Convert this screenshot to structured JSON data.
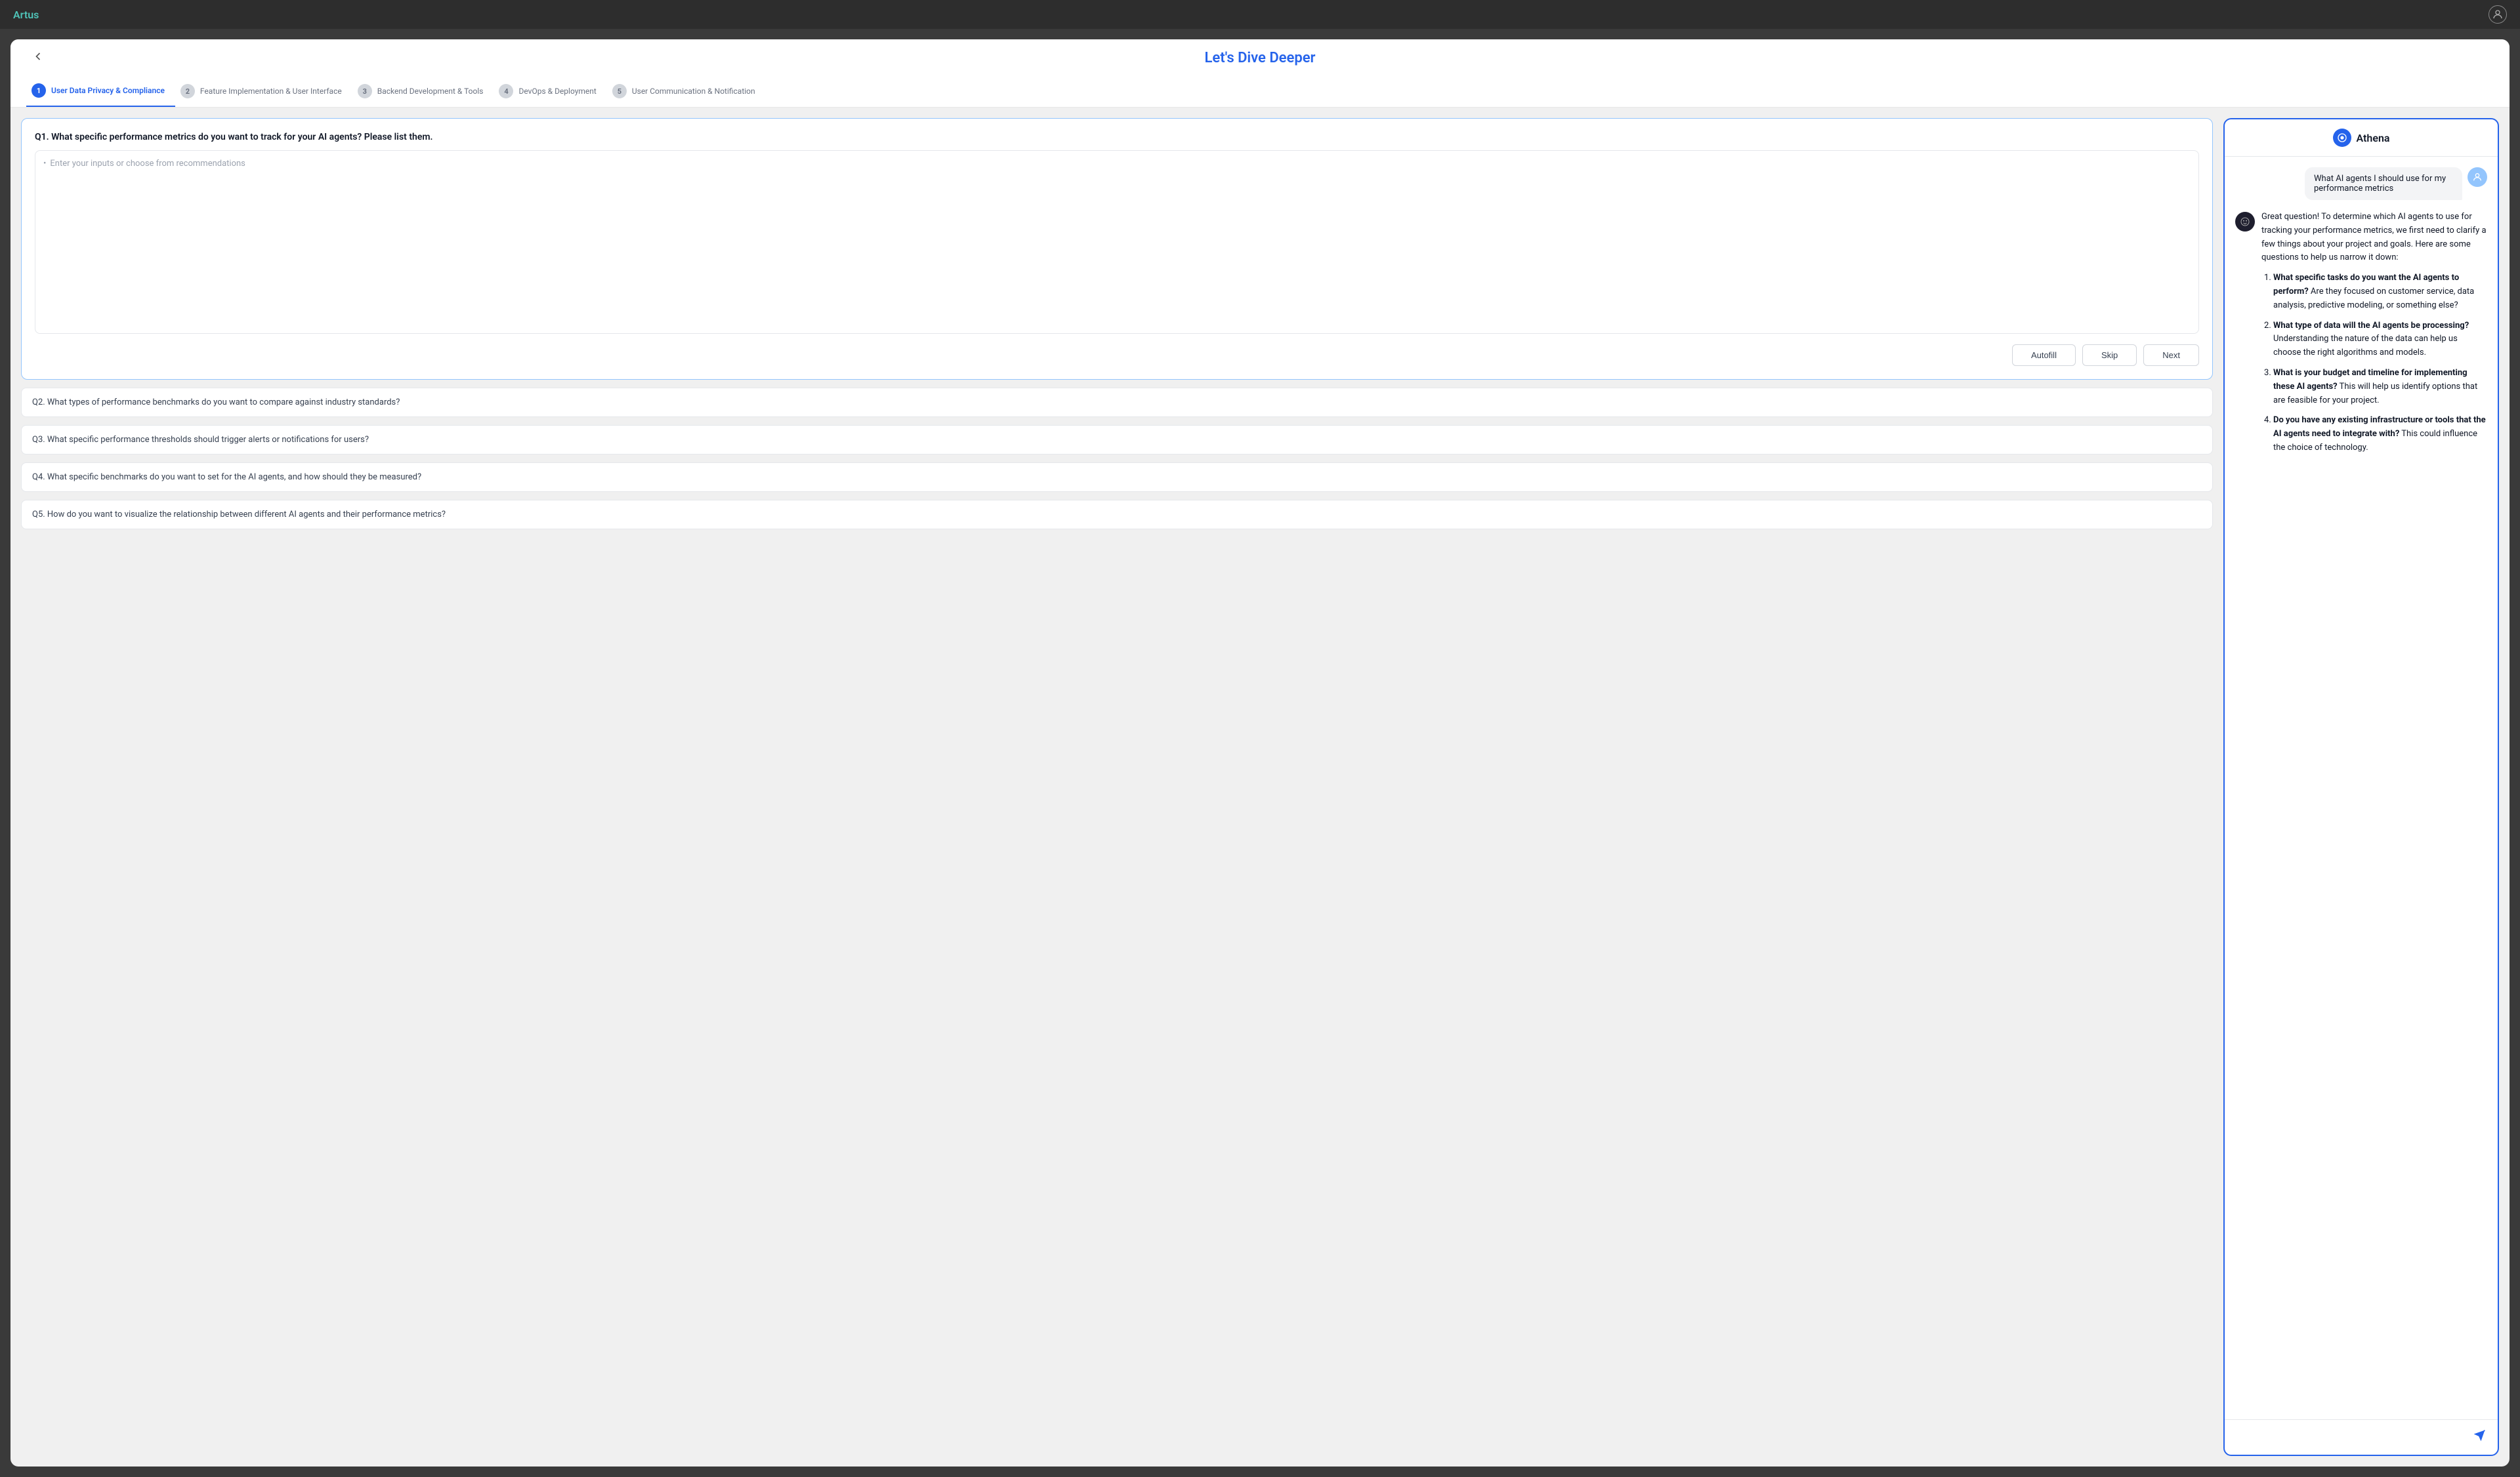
{
  "topbar": {
    "brand": "Artus"
  },
  "header": {
    "title": "Let's Dive Deeper",
    "back_label": "‹"
  },
  "steps": [
    {
      "num": "1",
      "label": "User Data Privacy & Compliance",
      "active": true
    },
    {
      "num": "2",
      "label": "Feature Implementation & User Interface",
      "active": false
    },
    {
      "num": "3",
      "label": "Backend Development & Tools",
      "active": false
    },
    {
      "num": "4",
      "label": "DevOps & Deployment",
      "active": false
    },
    {
      "num": "5",
      "label": "User Communication & Notification",
      "active": false
    }
  ],
  "q1": {
    "label": "Q1.  What specific performance metrics do you want to track for your AI agents? Please list them.",
    "placeholder": "Enter your inputs or choose from recommendations"
  },
  "buttons": {
    "autofill": "Autofill",
    "skip": "Skip",
    "next": "Next"
  },
  "other_questions": [
    "Q2. What types of performance benchmarks do you want to compare against industry standards?",
    "Q3. What specific performance thresholds should trigger alerts or notifications for users?",
    "Q4. What specific benchmarks do you want to set for the AI agents, and how should they be measured?",
    "Q5. How do you want to visualize the relationship between different AI agents and their performance metrics?"
  ],
  "athena": {
    "title": "Athena",
    "user_message": "What AI agents I should use for my performance metrics",
    "response_intro": "Great question! To determine which AI agents to use for tracking your performance metrics, we first need to clarify a few things about your project and goals. Here are some questions to help us narrow it down:",
    "response_items": [
      {
        "bold": "What specific tasks do you want the AI agents to perform?",
        "rest": " Are they focused on customer service, data analysis, predictive modeling, or something else?"
      },
      {
        "bold": "What type of data will the AI agents be processing?",
        "rest": " Understanding the nature of the data can help us choose the right algorithms and models."
      },
      {
        "bold": "What is your budget and timeline for implementing these AI agents?",
        "rest": " This will help us identify options that are feasible for your project."
      },
      {
        "bold": "Do you have any existing infrastructure or tools that the AI agents need to integrate with?",
        "rest": " This could influence the choice of technology."
      }
    ],
    "chat_placeholder": ""
  }
}
